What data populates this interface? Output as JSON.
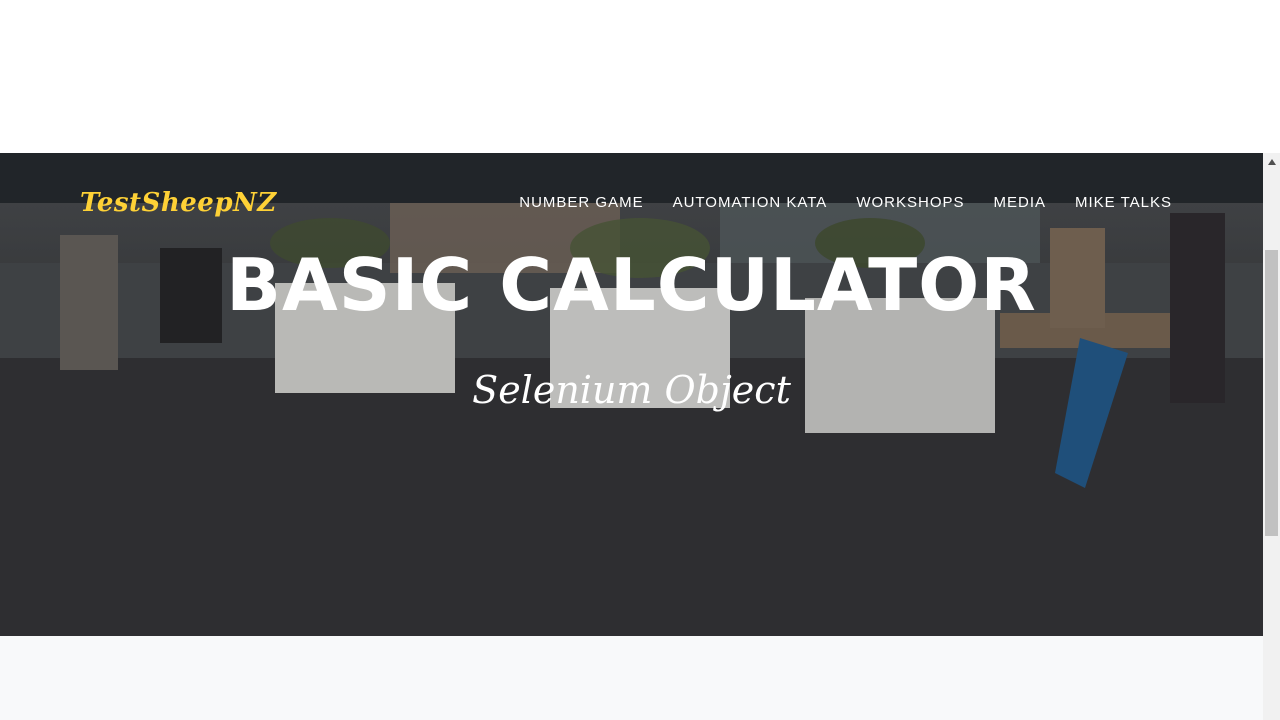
{
  "brand": {
    "name": "TestSheepNZ"
  },
  "nav": {
    "items": [
      {
        "label": "NUMBER GAME"
      },
      {
        "label": "AUTOMATION KATA"
      },
      {
        "label": "WORKSHOPS"
      },
      {
        "label": "MEDIA"
      },
      {
        "label": "MIKE TALKS"
      }
    ]
  },
  "hero": {
    "title": "BASIC CALCULATOR",
    "subtitle": "Selenium Object"
  },
  "colors": {
    "navbar_bg": "#212529",
    "brand": "#fed136",
    "nav_text": "#ffffff",
    "section_bg": "#f8f9fa",
    "scrollbar_track": "#f1f1f1",
    "scrollbar_thumb": "#c1c1c1"
  },
  "icons": {
    "scroll_up": "triangle-up-icon"
  }
}
